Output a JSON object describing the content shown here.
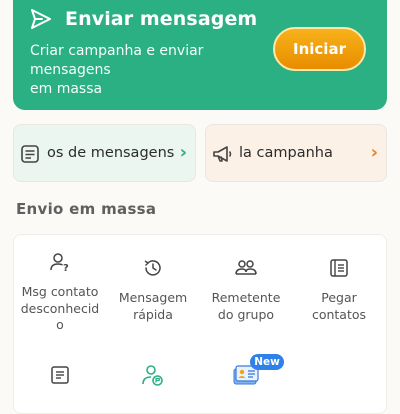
{
  "hero": {
    "icon": "send-icon",
    "title": "Enviar mensagem",
    "description_lines": [
      "Criar campanha e enviar",
      "mensagens",
      "em massa"
    ],
    "start_label": "Iniciar",
    "bg_color": "#2bb083",
    "button_color": "#f2a20e"
  },
  "shortcuts": [
    {
      "icon": "message-list-icon",
      "label": "os de mensagens",
      "chevron": "chevron-right-icon"
    },
    {
      "icon": "megaphone-icon",
      "label": "la campanha",
      "chevron": "chevron-right-icon"
    }
  ],
  "bulk_section": {
    "title": "Envio em massa",
    "tools": [
      {
        "icon": "unknown-contact-icon",
        "label_lines": [
          "Msg contato",
          "desconhecid",
          "o"
        ]
      },
      {
        "icon": "quick-message-icon",
        "label_lines": [
          "Mensagem",
          "rápida"
        ]
      },
      {
        "icon": "group-sender-icon",
        "label_lines": [
          "Remetente",
          "do grupo"
        ]
      },
      {
        "icon": "contact-list-icon",
        "label_lines": [
          "Pegar",
          "contatos"
        ]
      },
      {
        "icon": "document-icon",
        "label_lines": []
      },
      {
        "icon": "contact-filter-icon",
        "label_lines": []
      },
      {
        "icon": "id-card-icon",
        "label_lines": [],
        "badge": "New"
      }
    ]
  }
}
